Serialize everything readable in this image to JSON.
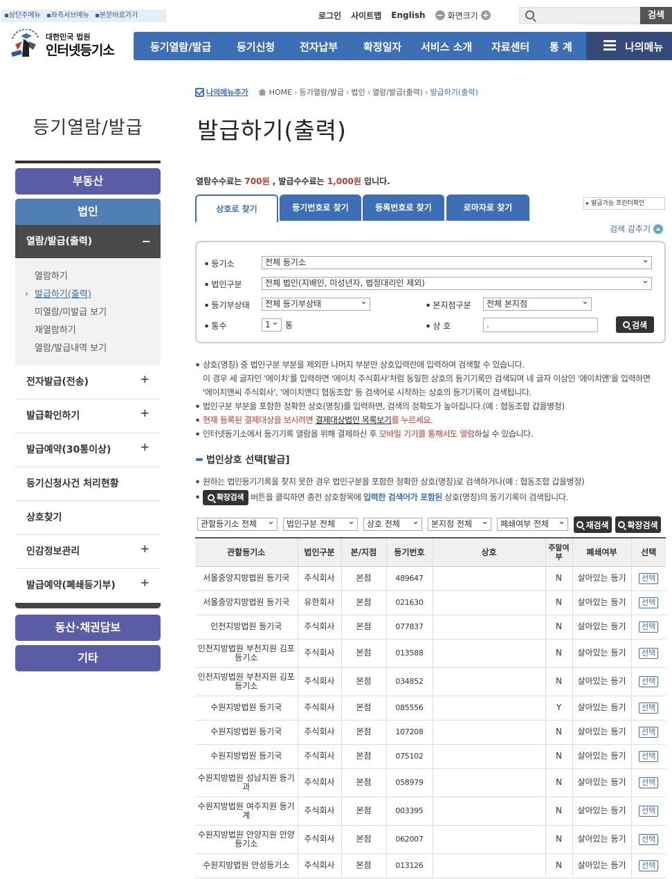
{
  "skip_links": [
    "▪상단주메뉴",
    "▪좌측서브메뉴",
    "▪본문바로가기"
  ],
  "util": {
    "login": "로그인",
    "sitemap": "사이트맵",
    "english": "English",
    "zoom_label": "화면크기",
    "zoom_minus": "−",
    "zoom_plus": "+",
    "search_button": "검색"
  },
  "logo": {
    "line1": "대한민국 법원",
    "line2": "인터넷등기소"
  },
  "gnb": [
    "등기열람/발급",
    "등기신청",
    "전자납부",
    "확정일자",
    "서비스 소개",
    "자료센터",
    "통 계"
  ],
  "my_menu": "나의메뉴",
  "lnb": {
    "title": "등기열람/발급",
    "real_estate": "부동산",
    "corporation": "법인",
    "active_sub": "열람/발급(출력)",
    "active_sub_toggle": "−",
    "sub_items": [
      "열람하기",
      "발급하기(출력)",
      "미열람/미발급 보기",
      "재열람하기",
      "열람/발급내역 보기"
    ],
    "menus": [
      {
        "label": "전자발급(전송)",
        "toggle": "+"
      },
      {
        "label": "발급확인하기",
        "toggle": "+"
      },
      {
        "label": "발급예약(30통이상)",
        "toggle": "+"
      },
      {
        "label": "등기신청사건 처리현황",
        "toggle": ""
      },
      {
        "label": "상호찾기",
        "toggle": ""
      },
      {
        "label": "인감정보관리",
        "toggle": "+"
      },
      {
        "label": "발급예약(폐쇄등기부)",
        "toggle": "+"
      }
    ],
    "movable": "동산·채권담보",
    "etc": "기타"
  },
  "breadcrumb": {
    "add_my": "나의메뉴추가",
    "items": [
      "HOME",
      "등기열람/발급",
      "법인",
      "열람/발급(출력)",
      "발급하기(출력)"
    ]
  },
  "page_title": "발급하기(출력)",
  "fee": {
    "pre": "열람수수료는 ",
    "view_fee": "700원",
    "mid": " , 발급수수료는 ",
    "issue_fee": "1,000원",
    "post": " 입니다."
  },
  "tabs": [
    "상호로 찾기",
    "등기번호로 찾기",
    "등록번호로 찾기",
    "로마자로 찾기"
  ],
  "printer_check": "발급가능 프린터확인",
  "collapse": "검색 감추기",
  "form": {
    "office_label": "등기소",
    "office_value": "전체 등기소",
    "corp_type_label": "법인구분",
    "corp_type_value": "전체 법인(지배인, 미성년자, 법정대리인 제외)",
    "status_label": "등기부상태",
    "status_value": "전체 등기부상태",
    "branch_label": "본지점구분",
    "branch_value": "전체 본지점",
    "copies_label": "통수",
    "copies_value": "1",
    "copies_unit": "통",
    "name_label": "상 호",
    "name_value": ".",
    "search_button": "검색"
  },
  "notes": {
    "n1": "상호(명칭) 중 법인구분 부분을 제외한 나머지 부분만 상호입력란에 입력하여 검색할 수 있습니다.",
    "n1b": "이 경우 세 글자인 '에이치'를 입력하면 '에이치 주식회사'처럼 동일한 상호의 등기기록만 검색되며 네 글자 이상인 '에이치앤'을 입력하면",
    "n1c": "'에이치앤씨 주식회사', '에이치앤디 협동조합' 등 검색어로 시작하는 상호의 등기기록이 검색됩니다.",
    "n2": "법인구분 부분을 포함한 정확한 상호(명칭)를 입력하면, 검색의 정확도가 높아집니다.(예 : 협동조합 갑을병정)",
    "n3_pre": "현재 등록된 결제대상을 보시려면 ",
    "n3_link": "결제대상법인 목록보기",
    "n3_post": "를 누르세요.",
    "n4_pre": "인터넷등기소에서 등기기록 열람을 위해 결제하신 후 ",
    "n4_red": "모바일 기기를 통해서도 열람",
    "n4_post": "하실 수 있습니다."
  },
  "section_title": "법인상호 선택[발급]",
  "notes2": {
    "m1": "원하는 법인등기기록을 찾지 못한 경우 법인구분을 포함한 정확한 상호(명칭)로 검색하거나(예 : 협동조합 갑을병정)",
    "m2_btn": "확장검색",
    "m2_pre": " 버튼을 클릭하면 종전 상호항목에 ",
    "m2_blue": "입력한 검색어가 포함된",
    "m2_post": " 상호(명칭)의 등기기록이 검색됩니다."
  },
  "filters": [
    "관할등기소 전체",
    "법인구분 전체",
    "상호 전체",
    "본지점 전체",
    "폐쇄여부 전체"
  ],
  "filter_buttons": [
    "재검색",
    "확장검색"
  ],
  "table": {
    "headers": [
      "관할등기소",
      "법인구분",
      "본/지점",
      "등기번호",
      "상호",
      "주말여부",
      "폐쇄여부",
      "선택"
    ],
    "rows": [
      {
        "office": "서울중앙지방법원 등기국",
        "type": "주식회사",
        "branch": "본점",
        "regno": "489647",
        "name": "",
        "weekend": "N",
        "status": "살아있는 등기",
        "pick": "선택"
      },
      {
        "office": "서울중앙지방법원 등기국",
        "type": "유한회사",
        "branch": "본점",
        "regno": "021630",
        "name": "",
        "weekend": "N",
        "status": "살아있는 등기",
        "pick": "선택"
      },
      {
        "office": "인천지방법원 등기국",
        "type": "주식회사",
        "branch": "본점",
        "regno": "077837",
        "name": "",
        "weekend": "N",
        "status": "살아있는 등기",
        "pick": "선택"
      },
      {
        "office": "인천지방법원 부천지원 김포등기소",
        "type": "주식회사",
        "branch": "본점",
        "regno": "013588",
        "name": "",
        "weekend": "N",
        "status": "살아있는 등기",
        "pick": "선택"
      },
      {
        "office": "인천지방법원 부천지원 김포등기소",
        "type": "주식회사",
        "branch": "본점",
        "regno": "034852",
        "name": "",
        "weekend": "N",
        "status": "살아있는 등기",
        "pick": "선택"
      },
      {
        "office": "수원지방법원 등기국",
        "type": "주식회사",
        "branch": "본점",
        "regno": "085556",
        "name": "",
        "weekend": "Y",
        "status": "살아있는 등기",
        "pick": "선택"
      },
      {
        "office": "수원지방법원 등기국",
        "type": "주식회사",
        "branch": "본점",
        "regno": "107208",
        "name": "",
        "weekend": "N",
        "status": "살아있는 등기",
        "pick": "선택"
      },
      {
        "office": "수원지방법원 등기국",
        "type": "주식회사",
        "branch": "본점",
        "regno": "075102",
        "name": "",
        "weekend": "N",
        "status": "살아있는 등기",
        "pick": "선택"
      },
      {
        "office": "수원지방법원 성남지원 등기과",
        "type": "주식회사",
        "branch": "본점",
        "regno": "058979",
        "name": "",
        "weekend": "N",
        "status": "살아있는 등기",
        "pick": "선택"
      },
      {
        "office": "수원지방법원 여주지원 등기계",
        "type": "주식회사",
        "branch": "본점",
        "regno": "003395",
        "name": "",
        "weekend": "N",
        "status": "살아있는 등기",
        "pick": "선택"
      },
      {
        "office": "수원지방법원 안양지원 안양등기소",
        "type": "주식회사",
        "branch": "본점",
        "regno": "062007",
        "name": "",
        "weekend": "N",
        "status": "살아있는 등기",
        "pick": "선택"
      },
      {
        "office": "수원지방법원 안성등기소",
        "type": "주식회사",
        "branch": "본점",
        "regno": "013126",
        "name": "",
        "weekend": "N",
        "status": "살아있는 등기",
        "pick": "선택"
      }
    ]
  }
}
